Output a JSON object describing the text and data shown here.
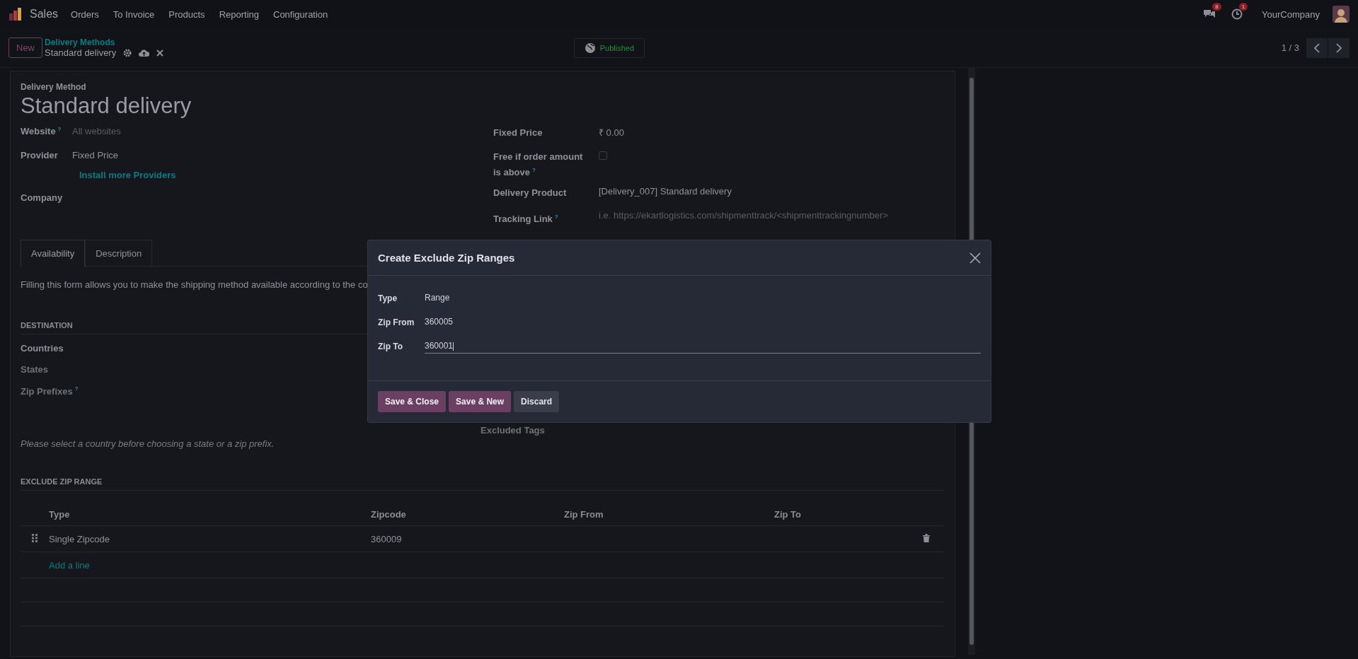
{
  "navbar": {
    "app_name": "Sales",
    "menu": [
      "Orders",
      "To Invoice",
      "Products",
      "Reporting",
      "Configuration"
    ],
    "messages_count": "8",
    "activities_count": "1",
    "company": "YourCompany"
  },
  "control_panel": {
    "new_button": "New",
    "breadcrumb_parent": "Delivery Methods",
    "record_name": "Standard delivery",
    "published_label": "Published",
    "pager": "1 / 3"
  },
  "form": {
    "section_label": "Delivery Method",
    "title": "Standard delivery",
    "fields_left": [
      {
        "kind": "field",
        "label": "Website",
        "help": "?",
        "placeholder": "All websites"
      },
      {
        "kind": "field",
        "label": "Provider",
        "value": "Fixed Price"
      },
      {
        "kind": "link",
        "value": "Install more Providers"
      },
      {
        "kind": "field",
        "label": "Company"
      }
    ],
    "fields_right": [
      {
        "kind": "field",
        "label": "Fixed Price",
        "value": "₹ 0.00"
      },
      {
        "kind": "checkbox",
        "label": "Free if order amount is above",
        "help": "?",
        "checked": false
      },
      {
        "kind": "field",
        "label": "Delivery Product",
        "value": "[Delivery_007] Standard delivery"
      },
      {
        "kind": "field",
        "label": "Tracking Link",
        "help": "?",
        "placeholder": "i.e. https://ekartlogistics.com/shipmenttrack/<shipmenttrackingnumber>"
      }
    ],
    "tabs": [
      {
        "label": "Availability",
        "selected": true
      },
      {
        "label": "Description",
        "selected": false
      }
    ],
    "availability_text": "Filling this form allows you to make the shipping method available according to the co",
    "destination": {
      "heading": "DESTINATION",
      "fields": [
        {
          "label": "Countries",
          "muted": false
        },
        {
          "label": "States",
          "muted": true
        },
        {
          "label": "Zip Prefixes",
          "help": "?",
          "muted": true
        }
      ],
      "excluded_tags_label": "Excluded Tags",
      "note": "Please select a country before choosing a state or a zip prefix."
    },
    "exclude_zip_range": {
      "heading": "EXCLUDE ZIP RANGE",
      "columns": [
        "Type",
        "Zipcode",
        "Zip From",
        "Zip To"
      ],
      "rows": [
        {
          "cells": [
            "Single Zipcode",
            "360009",
            "",
            ""
          ]
        }
      ],
      "add_line_label": "Add a line"
    }
  },
  "dialog": {
    "title": "Create Exclude Zip Ranges",
    "fields": [
      {
        "label": "Type",
        "value": "Range",
        "focused": false
      },
      {
        "label": "Zip From",
        "value": "360005",
        "focused": false
      },
      {
        "label": "Zip To",
        "value": "360001",
        "focused": true
      }
    ],
    "buttons": [
      {
        "label": "Save & Close",
        "kind": "primary"
      },
      {
        "label": "Save & New",
        "kind": "primary"
      },
      {
        "label": "Discard",
        "kind": "secondary"
      }
    ]
  }
}
